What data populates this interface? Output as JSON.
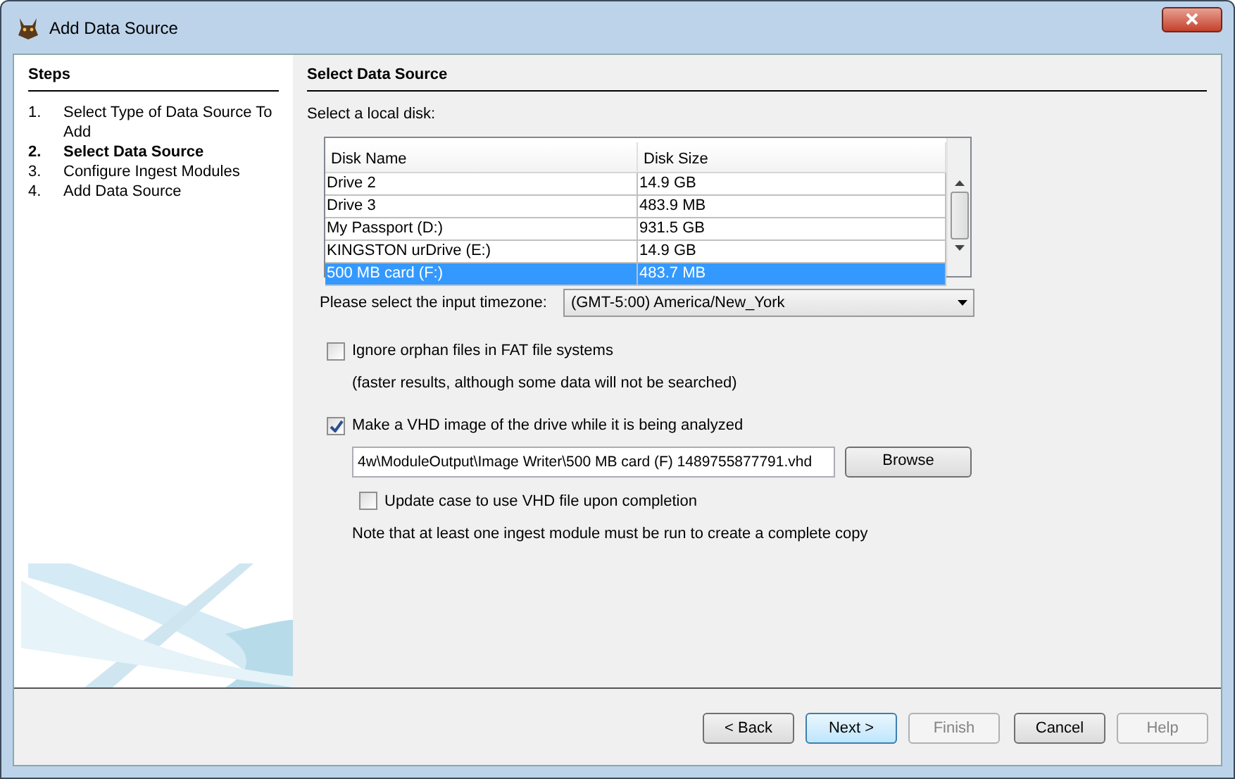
{
  "window": {
    "title": "Add Data Source"
  },
  "steps": {
    "heading": "Steps",
    "items": [
      {
        "number": "1.",
        "label": "Select Type of Data Source To Add",
        "selected": false
      },
      {
        "number": "2.",
        "label": "Select Data Source",
        "selected": true
      },
      {
        "number": "3.",
        "label": "Configure Ingest Modules",
        "selected": false
      },
      {
        "number": "4.",
        "label": "Add Data Source",
        "selected": false
      }
    ]
  },
  "panel": {
    "title": "Select Data Source",
    "disk_label": "Select a local disk:"
  },
  "table": {
    "columns": [
      "Disk Name",
      "Disk Size"
    ],
    "rows": [
      {
        "cells": [
          "Drive 2",
          "14.9 GB"
        ],
        "selected": false
      },
      {
        "cells": [
          "Drive 3",
          "483.9 MB"
        ],
        "selected": false
      },
      {
        "cells": [
          "My Passport (D:)",
          "931.5 GB"
        ],
        "selected": false
      },
      {
        "cells": [
          "KINGSTON urDrive (E:)",
          "14.9 GB"
        ],
        "selected": false
      },
      {
        "cells": [
          "500 MB card (F:)",
          "483.7 MB"
        ],
        "selected": true
      }
    ]
  },
  "timezone": {
    "label": "Please select the input timezone:",
    "value": "(GMT-5:00) America/New_York"
  },
  "ignore_orphans": {
    "label": "Ignore orphan files in FAT file systems",
    "checked": false,
    "note": "(faster results, although some data will not be searched)"
  },
  "vhd": {
    "label": "Make a VHD image of the drive while it is being analyzed",
    "checked": true,
    "path": "4w\\ModuleOutput\\Image Writer\\500 MB card (F) 1489755877791.vhd",
    "browse": "Browse"
  },
  "update_case": {
    "label": "Update case to use VHD file upon completion",
    "checked": false
  },
  "note": "Note that at least one ingest module must be run to create a complete copy",
  "buttons": [
    {
      "label": "< Back",
      "disabled": false,
      "default": false
    },
    {
      "label": "Next >",
      "disabled": false,
      "default": true
    },
    {
      "label": "Finish",
      "disabled": true,
      "default": false
    },
    {
      "label": "Cancel",
      "disabled": false,
      "default": false
    },
    {
      "label": "Help",
      "disabled": true,
      "default": false
    }
  ]
}
